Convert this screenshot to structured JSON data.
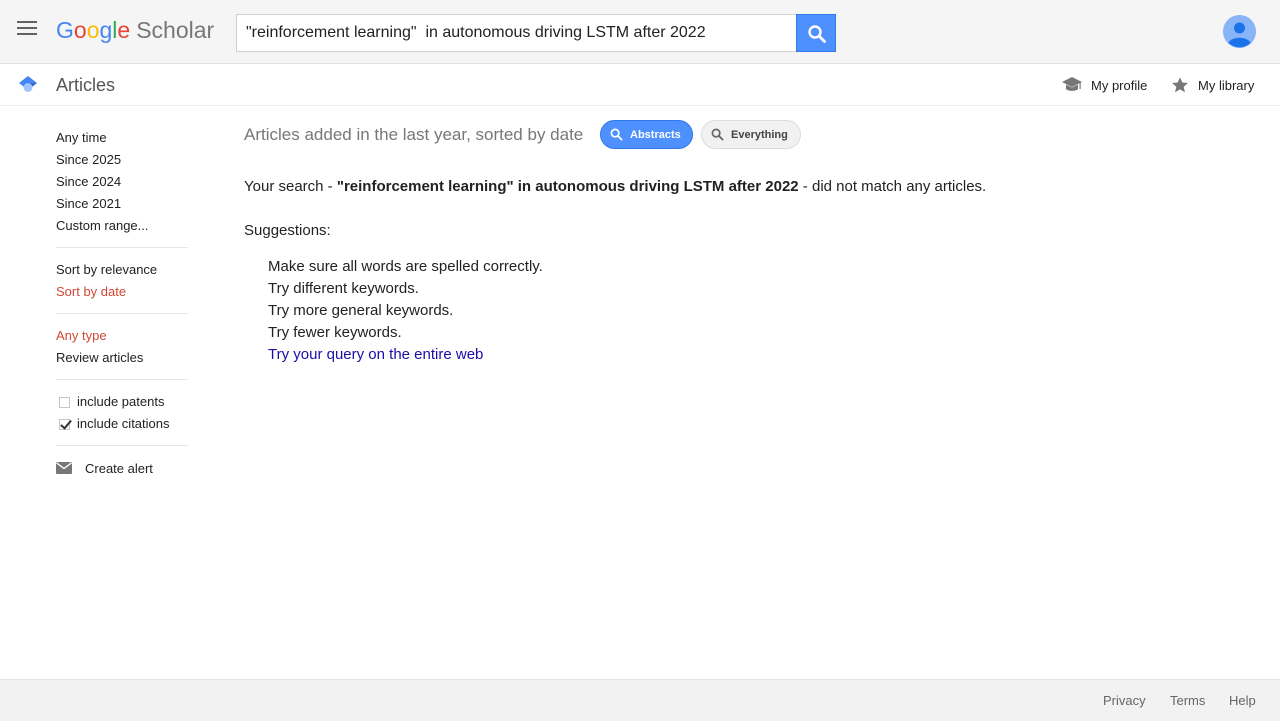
{
  "header": {
    "logo": {
      "g1": "G",
      "o1": "o",
      "o2": "o",
      "g2": "g",
      "l": "l",
      "e": "e",
      "product": "Scholar"
    },
    "search": {
      "value": "\"reinforcement learning\"  in autonomous driving LSTM after 2022"
    },
    "icons": {
      "menu": "hamburger-menu-icon",
      "search": "search-icon",
      "avatar": "account-avatar"
    }
  },
  "subheader": {
    "title": "Articles",
    "my_profile": "My profile",
    "my_library": "My library"
  },
  "sidebar": {
    "time_filters": [
      "Any time",
      "Since 2025",
      "Since 2024",
      "Since 2021",
      "Custom range..."
    ],
    "sort_options": [
      "Sort by relevance",
      "Sort by date"
    ],
    "type_options": [
      "Any type",
      "Review articles"
    ],
    "include_patents": {
      "label": "include patents",
      "checked": false
    },
    "include_citations": {
      "label": "include citations",
      "checked": true
    },
    "create_alert": "Create alert"
  },
  "main": {
    "results_summary": "Articles added in the last year, sorted by date",
    "abstracts_label": "Abstracts",
    "everything_label": "Everything",
    "no_match_prefix": "Your search - ",
    "no_match_query": "\"reinforcement learning\" in autonomous driving LSTM after 2022",
    "no_match_suffix": " - did not match any articles.",
    "suggestions_title": "Suggestions:",
    "suggestions": [
      "Make sure all words are spelled correctly.",
      "Try different keywords.",
      "Try more general keywords.",
      "Try fewer keywords."
    ],
    "web_link": "Try your query on the entire web"
  },
  "footer": {
    "privacy": "Privacy",
    "terms": "Terms",
    "help": "Help"
  },
  "colors": {
    "accent_blue": "#4d90fe",
    "active_red": "#d14836",
    "link": "#1a0dab"
  }
}
